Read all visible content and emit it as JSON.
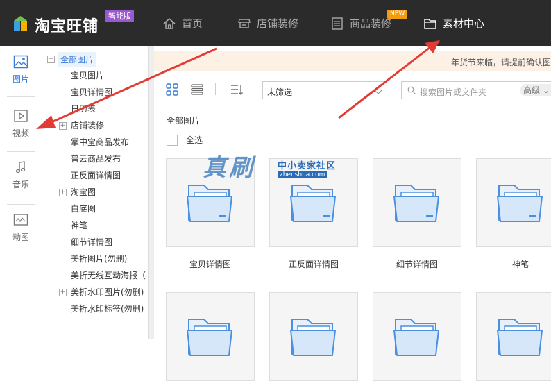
{
  "app": {
    "logo_text": "淘宝旺铺",
    "badge": "智能版"
  },
  "nav": {
    "home": "首页",
    "store_decor": "店铺装修",
    "product_decor": "商品装修",
    "product_decor_tag": "NEW",
    "material_center": "素材中心"
  },
  "sidebar": {
    "items": [
      {
        "label": "图片",
        "icon": "image-icon"
      },
      {
        "label": "视频",
        "icon": "video-icon"
      },
      {
        "label": "音乐",
        "icon": "music-icon"
      },
      {
        "label": "动图",
        "icon": "gif-icon"
      }
    ]
  },
  "tree": {
    "root": "全部图片",
    "items": [
      {
        "label": "宝贝图片"
      },
      {
        "label": "宝贝详情图"
      },
      {
        "label": "日历表"
      },
      {
        "label": "店铺装修"
      },
      {
        "label": "掌中宝商品发布"
      },
      {
        "label": "普云商品发布"
      },
      {
        "label": "正反面详情图"
      },
      {
        "label": "淘宝图"
      },
      {
        "label": "白底图"
      },
      {
        "label": "神笔"
      },
      {
        "label": "细节详情图"
      },
      {
        "label": "美折图片(勿删)"
      },
      {
        "label": "美折无线互动海报（"
      },
      {
        "label": "美折水印图片(勿删)"
      },
      {
        "label": "美折水印标签(勿删)"
      }
    ]
  },
  "main": {
    "notice": "年货节来临，请提前确认图",
    "filter_value": "未筛选",
    "search_placeholder": "搜索图片或文件夹",
    "advanced": "高级",
    "breadcrumb": "全部图片",
    "select_all": "全选",
    "folders": [
      {
        "name": "宝贝详情图"
      },
      {
        "name": "正反面详情图"
      },
      {
        "name": "细节详情图"
      },
      {
        "name": "神笔"
      },
      {
        "name": ""
      },
      {
        "name": ""
      },
      {
        "name": ""
      },
      {
        "name": ""
      }
    ]
  },
  "watermark": {
    "big": "真刷",
    "small": "中小卖家社区",
    "url": "zhenshua.com"
  },
  "colors": {
    "topbar": "#2b2b2b",
    "accent": "#3a7bd5",
    "arrow": "#e23b35",
    "folder": "#4a90e2"
  }
}
